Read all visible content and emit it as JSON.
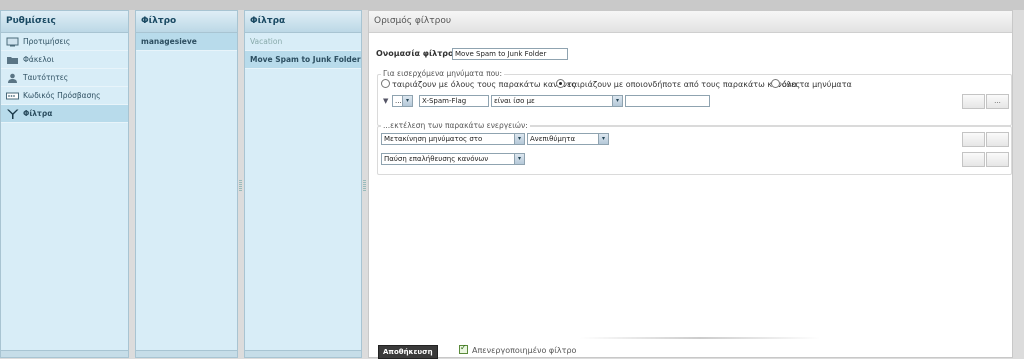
{
  "settings_panel": {
    "title": "Ρυθμίσεις",
    "items": [
      {
        "label": "Προτιμήσεις",
        "icon": "monitor-icon"
      },
      {
        "label": "Φάκελοι",
        "icon": "folder-icon"
      },
      {
        "label": "Ταυτότητες",
        "icon": "person-icon"
      },
      {
        "label": "Κωδικός Πρόσβασης",
        "icon": "password-icon"
      },
      {
        "label": "Φίλτρα",
        "icon": "filter-icon"
      }
    ]
  },
  "filterset_panel": {
    "title": "Φίλτρο",
    "items": [
      "managesieve"
    ]
  },
  "filters_panel": {
    "title": "Φίλτρα",
    "items": [
      "Vacation",
      "Move Spam to Junk Folder"
    ]
  },
  "editor": {
    "title": "Ορισμός φίλτρου",
    "name_label": "Ονομασία φίλτρου:",
    "name_value": "Move Spam to Junk Folder",
    "rules_legend": "Για εισερχόμενα μηνύματα που:",
    "match_all": "ταιριάζουν με όλους τους παρακάτω κανόνες",
    "match_any": "ταιριάζουν με οποιονδήποτε από τους παρακάτω κανόνες",
    "match_all_messages": "όλα τα μηνύματα",
    "rule": {
      "prefix_select": "...",
      "header_value": "X-Spam-Flag",
      "operator": "είναι ίσο με",
      "value": ""
    },
    "rule_add": "",
    "rule_remove": "...",
    "actions_legend": "...εκτέλεση των παρακάτω ενεργειών:",
    "action1": "Μετακίνηση μηνύματος στο",
    "action1_target": "Ανεπιθύμητα",
    "action2": "Παύση επαλήθευσης κανόνων",
    "save_label": "Αποθήκευση",
    "disabled_label": "Απενεργοποιημένο φίλτρο"
  }
}
